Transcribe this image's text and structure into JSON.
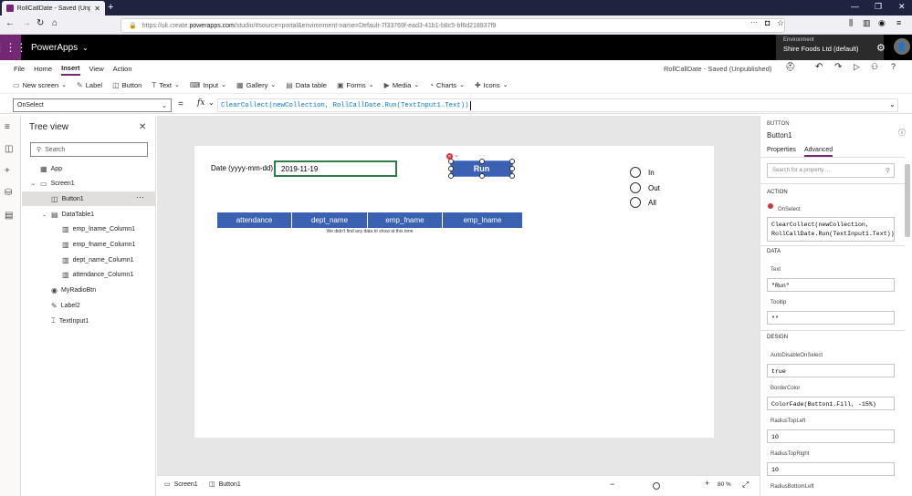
{
  "browser": {
    "tab_title": "RollCallDate - Saved (Unpublis",
    "url_prefix": "https://uk.create.",
    "url_domain": "powerapps.com",
    "url_rest": "/studio/#source=portal&environment-name=Default-7f33769f-ead3-41b1-b8c5-bf6d218937f9"
  },
  "header": {
    "app_name": "PowerApps",
    "env_label": "Environment",
    "env_value": "Shire Foods Ltd (default)"
  },
  "menu": [
    "File",
    "Home",
    "Insert",
    "View",
    "Action"
  ],
  "menu_active": "Insert",
  "saved_title": "RollCallDate - Saved (Unpublished)",
  "ribbon": [
    {
      "label": "New screen",
      "icon": "new-screen-icon",
      "dropdown": true
    },
    {
      "label": "Label",
      "icon": "label-icon",
      "dropdown": false
    },
    {
      "label": "Button",
      "icon": "button-icon",
      "dropdown": false
    },
    {
      "label": "Text",
      "icon": "text-icon",
      "dropdown": true
    },
    {
      "label": "Input",
      "icon": "input-icon",
      "dropdown": true
    },
    {
      "label": "Gallery",
      "icon": "gallery-icon",
      "dropdown": true
    },
    {
      "label": "Data table",
      "icon": "data-table-icon",
      "dropdown": false
    },
    {
      "label": "Forms",
      "icon": "forms-icon",
      "dropdown": true
    },
    {
      "label": "Media",
      "icon": "media-icon",
      "dropdown": true
    },
    {
      "label": "Charts",
      "icon": "charts-icon",
      "dropdown": true
    },
    {
      "label": "Icons",
      "icon": "icons-icon",
      "dropdown": true
    }
  ],
  "formula_bar": {
    "property": "OnSelect",
    "equals": "=",
    "fx": "fx",
    "formula": "ClearCollect(newCollection, RollCallDate.Run(TextInput1.Text))"
  },
  "tree": {
    "title": "Tree view",
    "search_placeholder": "Search",
    "items": [
      {
        "label": "App",
        "icon": "app-icon",
        "indent": 0,
        "chevron": false,
        "selected": false
      },
      {
        "label": "Screen1",
        "icon": "screen-icon",
        "indent": 0,
        "chevron": true,
        "selected": false
      },
      {
        "label": "Button1",
        "icon": "button-icon",
        "indent": 1,
        "chevron": false,
        "selected": true
      },
      {
        "label": "DataTable1",
        "icon": "data-table-icon",
        "indent": 1,
        "chevron": true,
        "selected": false
      },
      {
        "label": "emp_lname_Column1",
        "icon": "column-icon",
        "indent": 2,
        "chevron": false,
        "selected": false
      },
      {
        "label": "emp_fname_Column1",
        "icon": "column-icon",
        "indent": 2,
        "chevron": false,
        "selected": false
      },
      {
        "label": "dept_name_Column1",
        "icon": "column-icon",
        "indent": 2,
        "chevron": false,
        "selected": false
      },
      {
        "label": "attendance_Column1",
        "icon": "column-icon",
        "indent": 2,
        "chevron": false,
        "selected": false
      },
      {
        "label": "MyRadioBtn",
        "icon": "radio-icon",
        "indent": 1,
        "chevron": false,
        "selected": false
      },
      {
        "label": "Label2",
        "icon": "label-icon",
        "indent": 1,
        "chevron": false,
        "selected": false
      },
      {
        "label": "TextInput1",
        "icon": "text-input-icon",
        "indent": 1,
        "chevron": false,
        "selected": false
      }
    ]
  },
  "canvas": {
    "date_label": "Date (yyyy-mm-dd)",
    "date_value": "2019-11-19",
    "run_button": "Run",
    "radio_options": [
      "In",
      "Out",
      "All"
    ],
    "table_columns": [
      "attendance",
      "dept_name",
      "emp_fname",
      "emp_lname"
    ],
    "table_empty": "We didn't find any data to show at this time"
  },
  "status": {
    "screen_tab": "Screen1",
    "control_tab": "Button1",
    "zoom_minus": "−",
    "zoom_plus": "+",
    "zoom": "80 %"
  },
  "properties": {
    "type": "BUTTON",
    "name": "Button1",
    "tab_properties": "Properties",
    "tab_advanced": "Advanced",
    "search_placeholder": "Search for a property ...",
    "section_action": "ACTION",
    "onselect_label": "OnSelect",
    "onselect_value": "ClearCollect(newCollection, RollCallDate.Run(TextInput1.Text))",
    "section_data": "DATA",
    "text_label": "Text",
    "text_value": "\"Run\"",
    "tooltip_label": "Tooltip",
    "tooltip_value": "\"\"",
    "section_design": "DESIGN",
    "autodisable_label": "AutoDisableOnSelect",
    "autodisable_value": "true",
    "bordercolor_label": "BorderColor",
    "bordercolor_value": "ColorFade(Button1.Fill, -15%)",
    "radiustopleft_label": "RadiusTopLeft",
    "radiustopleft_value": "10",
    "radiustopright_label": "RadiusTopRight",
    "radiustopright_value": "10",
    "radiusbottomleft_label": "RadiusBottomLeft"
  },
  "colors": {
    "brand": "#742774",
    "button_fill": "#3b61b2",
    "error": "#d13438",
    "focus_border": "#2e7d46"
  }
}
